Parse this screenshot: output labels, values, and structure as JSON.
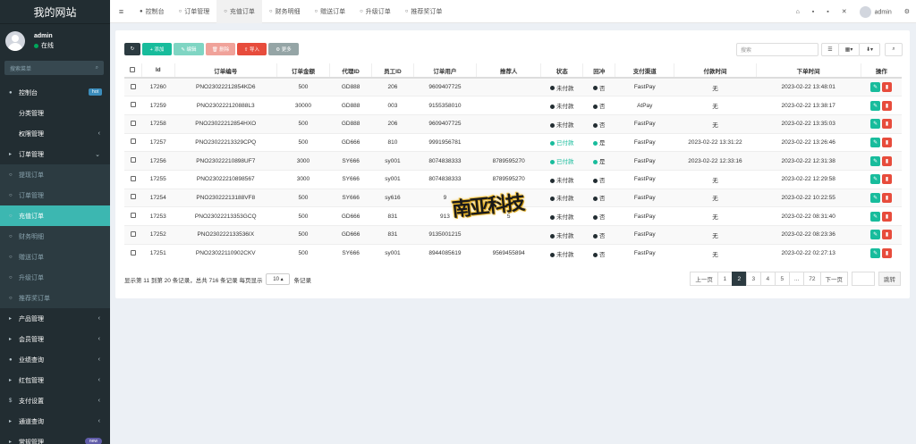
{
  "brand": "我的网站",
  "user": {
    "name": "admin",
    "status": "在线"
  },
  "sidebar_search_placeholder": "搜索菜单",
  "menu": [
    {
      "icon": "●",
      "label": "控制台",
      "badge": "hot",
      "type": "top"
    },
    {
      "icon": "",
      "label": "分类管理",
      "type": "top"
    },
    {
      "icon": "",
      "label": "权限管理",
      "caret": "‹",
      "type": "top"
    },
    {
      "icon": "▸",
      "label": "订单管理",
      "caret": "⌄",
      "type": "top"
    },
    {
      "icon": "○",
      "label": "提现订单",
      "type": "sub"
    },
    {
      "icon": "○",
      "label": "订单管理",
      "type": "sub"
    },
    {
      "icon": "○",
      "label": "充值订单",
      "type": "sub",
      "active": true
    },
    {
      "icon": "○",
      "label": "财务明细",
      "type": "sub"
    },
    {
      "icon": "○",
      "label": "赠送订单",
      "type": "sub"
    },
    {
      "icon": "○",
      "label": "升级订单",
      "type": "sub"
    },
    {
      "icon": "○",
      "label": "推荐奖订单",
      "type": "sub"
    },
    {
      "icon": "▸",
      "label": "产品管理",
      "caret": "‹",
      "type": "top"
    },
    {
      "icon": "▸",
      "label": "会员管理",
      "caret": "‹",
      "type": "top"
    },
    {
      "icon": "●",
      "label": "业绩查询",
      "caret": "‹",
      "type": "top"
    },
    {
      "icon": "▸",
      "label": "红包管理",
      "caret": "‹",
      "type": "top"
    },
    {
      "icon": "$",
      "label": "支付设置",
      "caret": "‹",
      "type": "top"
    },
    {
      "icon": "▸",
      "label": "通道查询",
      "caret": "‹",
      "type": "top"
    },
    {
      "icon": "▸",
      "label": "常规管理",
      "badge": "new",
      "type": "top"
    }
  ],
  "topnav": {
    "toggle": "≡",
    "tabs": [
      {
        "icon": "●",
        "label": "控制台"
      },
      {
        "icon": "○",
        "label": "订单管理"
      },
      {
        "icon": "○",
        "label": "充值订单",
        "active": true
      },
      {
        "icon": "○",
        "label": "财务明细"
      },
      {
        "icon": "○",
        "label": "赠送订单"
      },
      {
        "icon": "○",
        "label": "升级订单"
      },
      {
        "icon": "○",
        "label": "推荐奖订单"
      }
    ],
    "right_icons": [
      "⌂",
      "▪",
      "▪",
      "✕"
    ],
    "user": "admin",
    "settings_icon": "⚙"
  },
  "toolbar": {
    "refresh": "↻",
    "add": "+ 添加",
    "edit": "✎ 编辑",
    "delete": "🗑 删除",
    "import": "⇧ 导入",
    "more": "⚙ 更多",
    "search_placeholder": "搜索",
    "view_icon": "☰",
    "grid_icon": "▦▾",
    "export_icon": "⬇▾",
    "search_icon": "⌕"
  },
  "table": {
    "headers": [
      "",
      "Id",
      "订单编号",
      "订单金额",
      "代理ID",
      "员工ID",
      "订单用户",
      "推荐人",
      "状态",
      "回冲",
      "支付渠道",
      "付款时间",
      "下单时间",
      "操作"
    ],
    "rows": [
      {
        "id": "17260",
        "no": "PNO23022212854KD6",
        "amount": "500",
        "agent": "GD888",
        "staff": "206",
        "user": "9609407725",
        "ref": "",
        "status": "未付款",
        "paid": false,
        "back": "否",
        "backg": false,
        "channel": "FastPay",
        "paytime": "无",
        "ordertime": "2023-02-22 13:48:01"
      },
      {
        "id": "17259",
        "no": "PNO230222120888L3",
        "amount": "30000",
        "agent": "GD888",
        "staff": "003",
        "user": "9155358010",
        "ref": "",
        "status": "未付款",
        "paid": false,
        "back": "否",
        "backg": false,
        "channel": "AtPay",
        "paytime": "无",
        "ordertime": "2023-02-22 13:38:17"
      },
      {
        "id": "17258",
        "no": "PNO23022212854HXO",
        "amount": "500",
        "agent": "GD888",
        "staff": "206",
        "user": "9609407725",
        "ref": "",
        "status": "未付款",
        "paid": false,
        "back": "否",
        "backg": false,
        "channel": "FastPay",
        "paytime": "无",
        "ordertime": "2023-02-22 13:35:03"
      },
      {
        "id": "17257",
        "no": "PNO23022213329CPQ",
        "amount": "500",
        "agent": "GD666",
        "staff": "810",
        "user": "9991956781",
        "ref": "",
        "status": "已付款",
        "paid": true,
        "back": "是",
        "backg": true,
        "channel": "FastPay",
        "paytime": "2023-02-22 13:31:22",
        "ordertime": "2023-02-22 13:26:46"
      },
      {
        "id": "17256",
        "no": "PNO23022210898UF7",
        "amount": "3000",
        "agent": "SY666",
        "staff": "sy001",
        "user": "8074838333",
        "ref": "8789595270",
        "status": "已付款",
        "paid": true,
        "back": "是",
        "backg": true,
        "channel": "FastPay",
        "paytime": "2023-02-22 12:33:16",
        "ordertime": "2023-02-22 12:31:38"
      },
      {
        "id": "17255",
        "no": "PNO23022210898567",
        "amount": "3000",
        "agent": "SY666",
        "staff": "sy001",
        "user": "8074838333",
        "ref": "8789595270",
        "status": "未付款",
        "paid": false,
        "back": "否",
        "backg": false,
        "channel": "FastPay",
        "paytime": "无",
        "ordertime": "2023-02-22 12:29:58"
      },
      {
        "id": "17254",
        "no": "PNO23022213188VF8",
        "amount": "500",
        "agent": "SY666",
        "staff": "sy616",
        "user": "9",
        "ref": "",
        "status": "未付款",
        "paid": false,
        "back": "否",
        "backg": false,
        "channel": "FastPay",
        "paytime": "无",
        "ordertime": "2023-02-22 10:22:55"
      },
      {
        "id": "17253",
        "no": "PNO23022213353GCQ",
        "amount": "500",
        "agent": "GD666",
        "staff": "831",
        "user": "913",
        "ref": "5",
        "status": "未付款",
        "paid": false,
        "back": "否",
        "backg": false,
        "channel": "FastPay",
        "paytime": "无",
        "ordertime": "2023-02-22 08:31:40"
      },
      {
        "id": "17252",
        "no": "PNO230222133536IX",
        "amount": "500",
        "agent": "GD666",
        "staff": "831",
        "user": "9135001215",
        "ref": "",
        "status": "未付款",
        "paid": false,
        "back": "否",
        "backg": false,
        "channel": "FastPay",
        "paytime": "无",
        "ordertime": "2023-02-22 08:23:36"
      },
      {
        "id": "17251",
        "no": "PNO23022110902CKV",
        "amount": "500",
        "agent": "SY666",
        "staff": "sy001",
        "user": "8944085619",
        "ref": "9569455894",
        "status": "未付款",
        "paid": false,
        "back": "否",
        "backg": false,
        "channel": "FastPay",
        "paytime": "无",
        "ordertime": "2023-02-22 02:27:13"
      }
    ]
  },
  "footer": {
    "info_left": "显示第 11 到第 20 条记录，总共 716 条记录 每页显示",
    "page_size": "10 ▴",
    "info_right": "条记录"
  },
  "pagination": [
    "上一页",
    "1",
    "2",
    "3",
    "4",
    "5",
    "...",
    "72",
    "下一页"
  ],
  "pagination_active": "2",
  "goto": "跳转",
  "watermark": "南亚科技",
  "colors": {
    "sidebar": "#222d32",
    "active": "#3cb7b1",
    "success": "#18bc9c",
    "danger": "#e74c3c"
  }
}
